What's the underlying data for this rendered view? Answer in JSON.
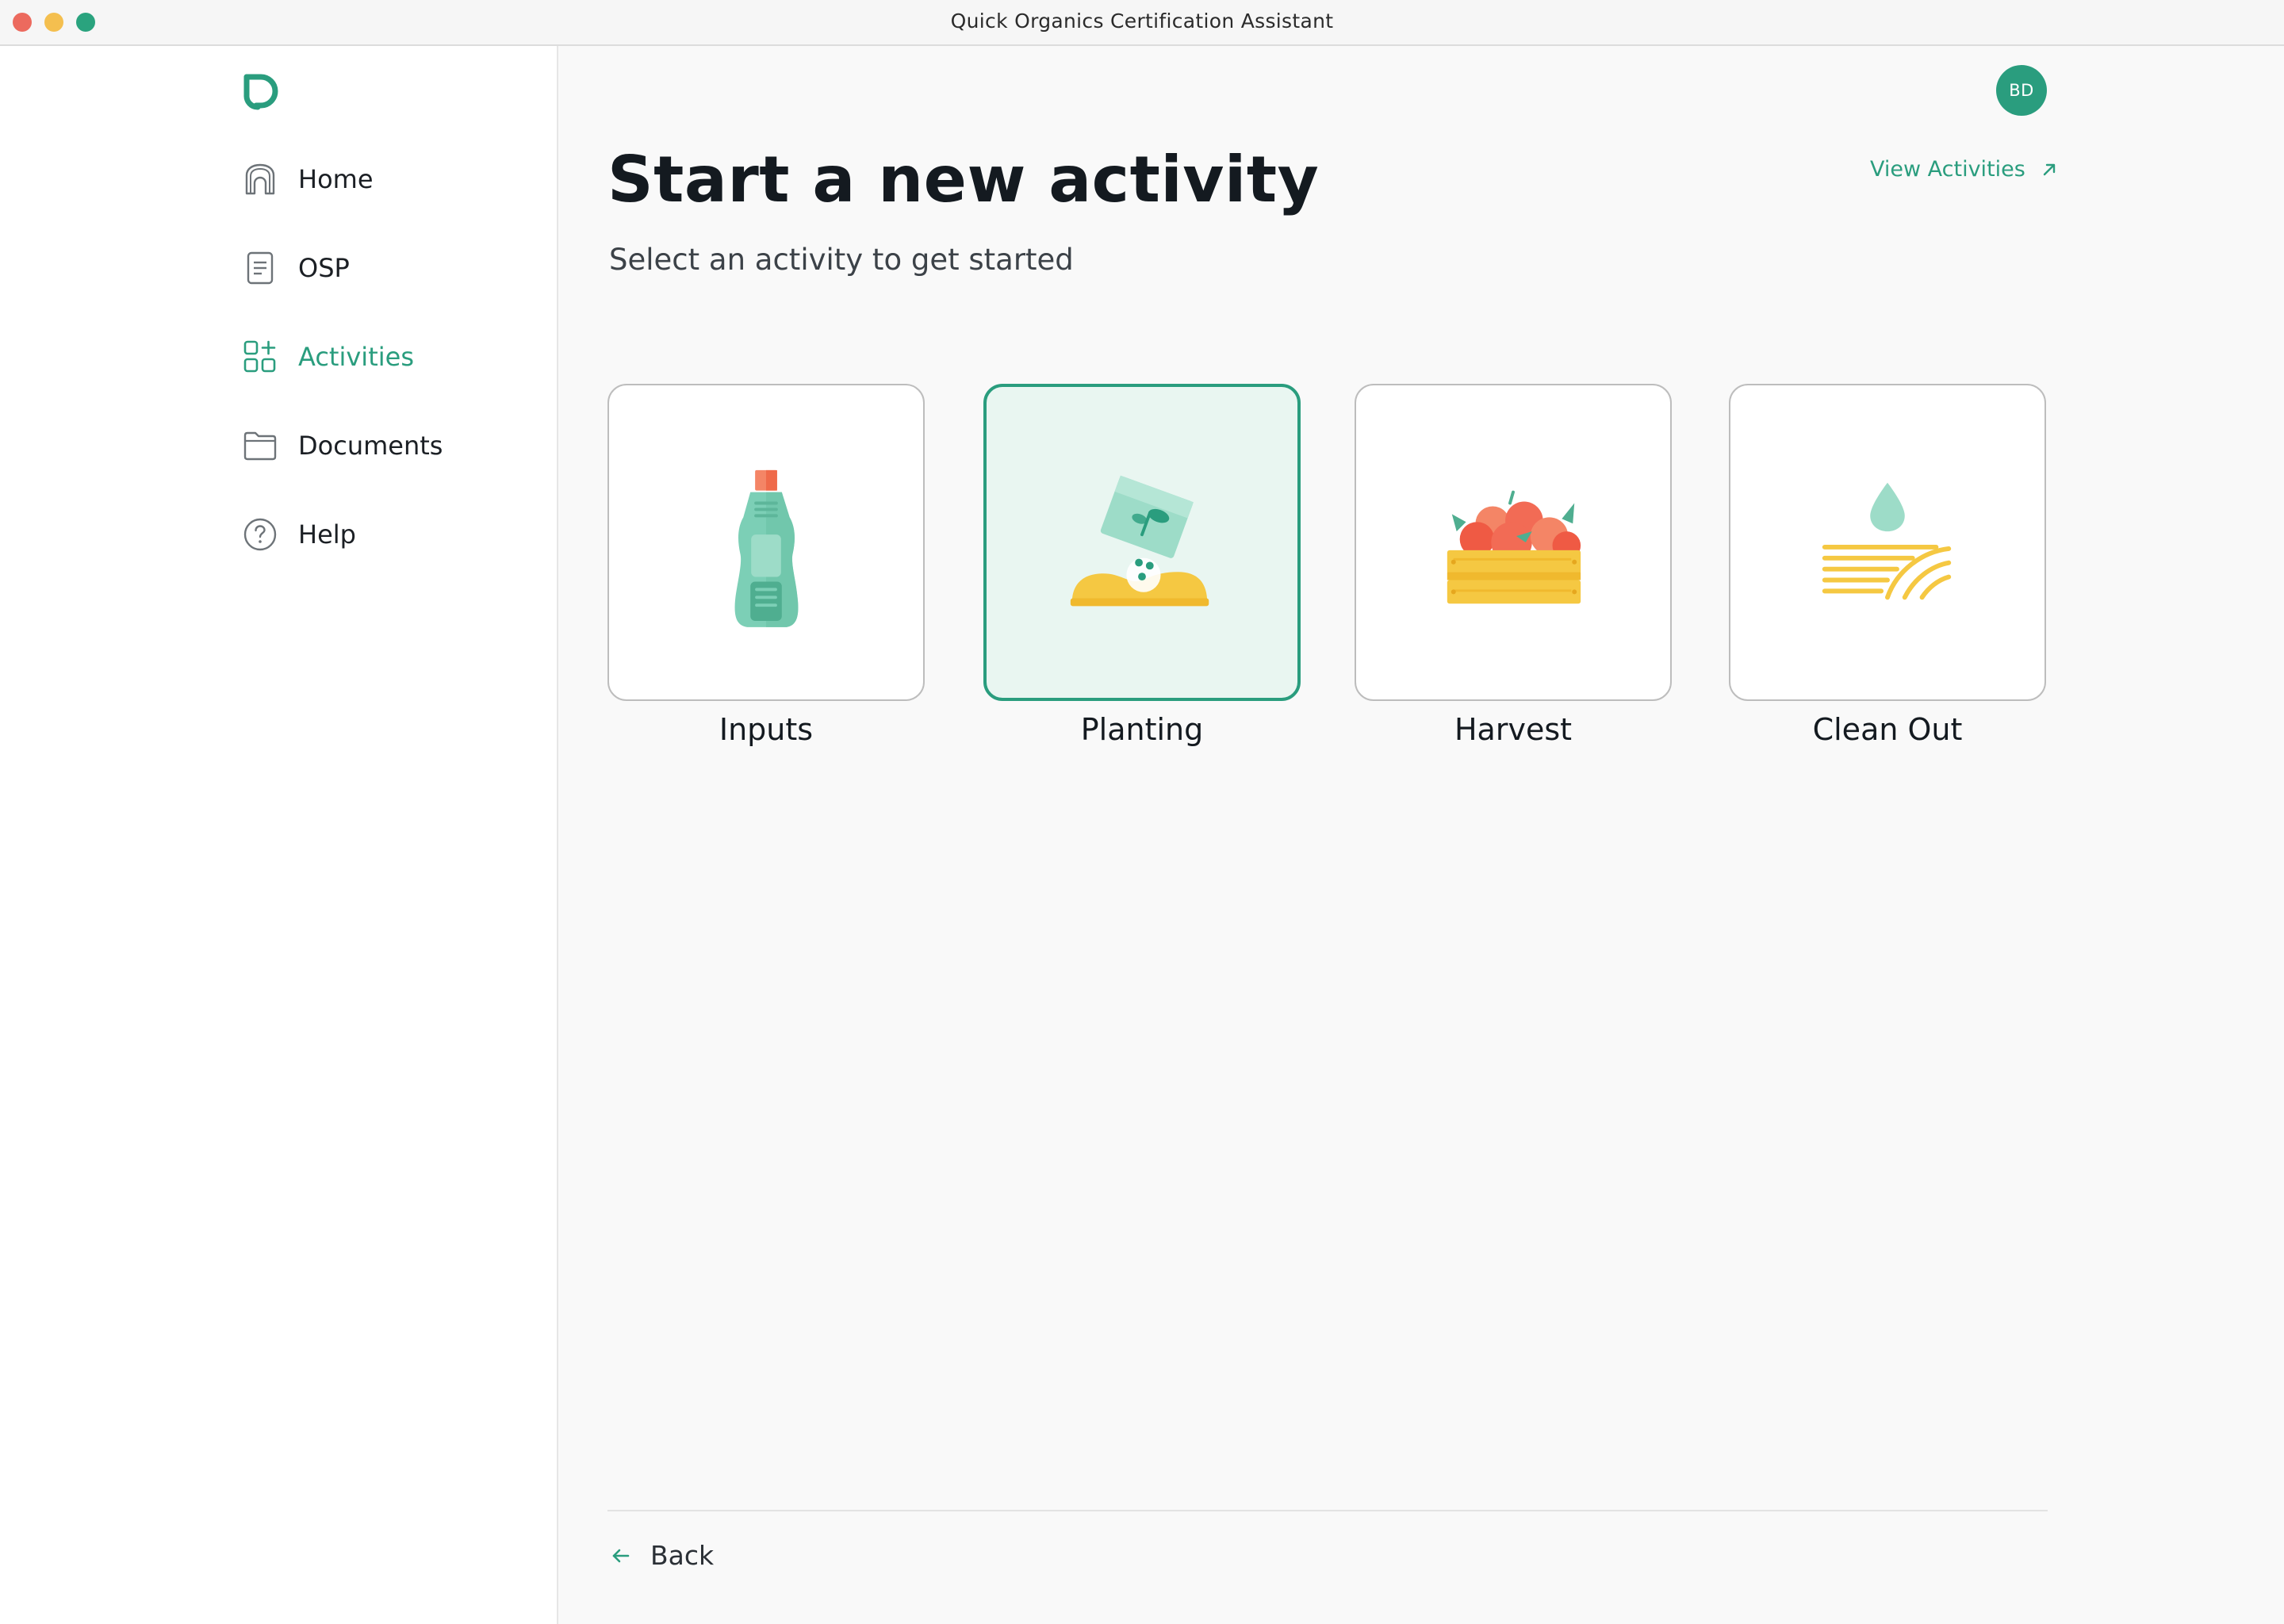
{
  "window": {
    "title": "Quick Organics Certification Assistant"
  },
  "sidebar": {
    "items": [
      {
        "label": "Home",
        "icon": "home-icon",
        "active": false
      },
      {
        "label": "OSP",
        "icon": "document-icon",
        "active": false
      },
      {
        "label": "Activities",
        "icon": "activities-grid-icon",
        "active": true
      },
      {
        "label": "Documents",
        "icon": "folder-icon",
        "active": false
      },
      {
        "label": "Help",
        "icon": "help-icon",
        "active": false
      }
    ]
  },
  "header": {
    "avatar_initials": "BD",
    "title": "Start a new activity",
    "subtitle": "Select an activity to get started",
    "view_link": "View Activities"
  },
  "activities": [
    {
      "label": "Inputs",
      "icon": "bottle-icon",
      "selected": false
    },
    {
      "label": "Planting",
      "icon": "seed-planting-icon",
      "selected": true
    },
    {
      "label": "Harvest",
      "icon": "fruit-crate-icon",
      "selected": false
    },
    {
      "label": "Clean Out",
      "icon": "water-drop-field-icon",
      "selected": false
    }
  ],
  "footer": {
    "back_label": "Back"
  },
  "colors": {
    "accent": "#2a9d7e",
    "selected_bg": "#e9f6f1",
    "yellow": "#f5c842",
    "coral": "#f26b55"
  }
}
